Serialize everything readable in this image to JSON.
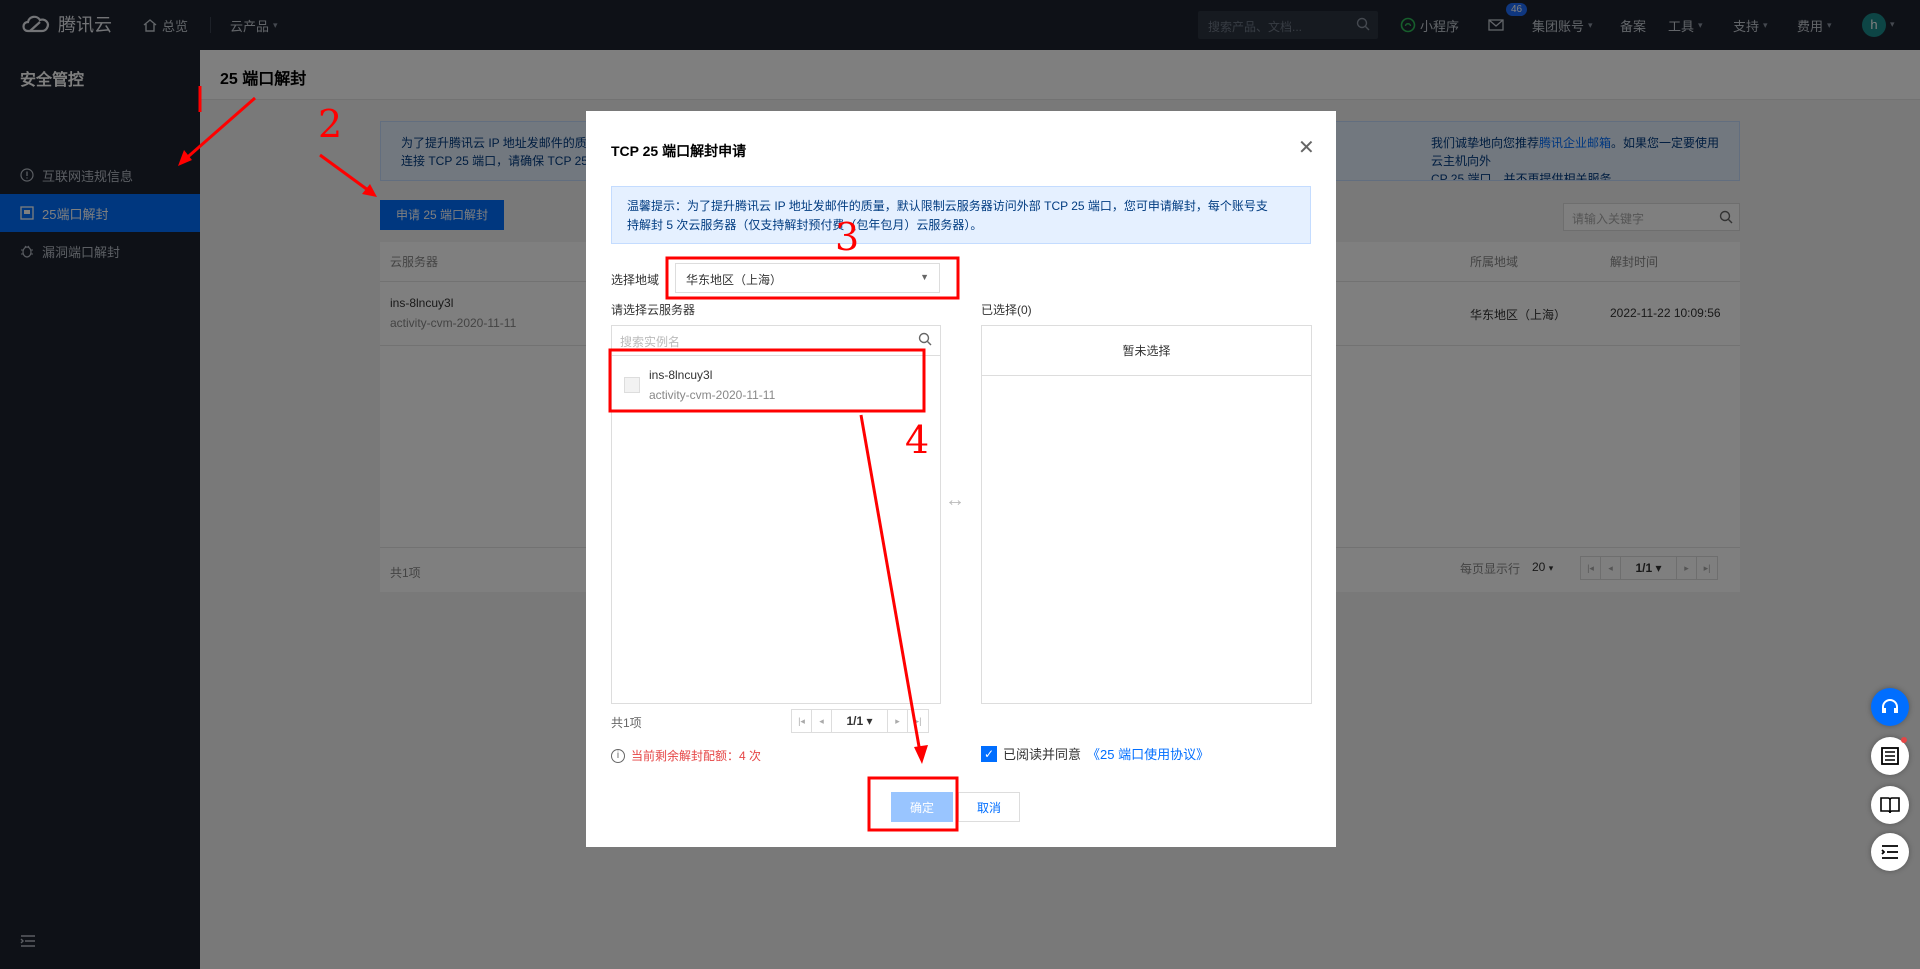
{
  "topbar": {
    "logo_text": "腾讯云",
    "overview": "总览",
    "products": "云产品",
    "search_placeholder": "搜索产品、文档...",
    "mini_program": "小程序",
    "mail_badge": "46",
    "group_account": "集团账号",
    "filing": "备案",
    "tools": "工具",
    "support": "支持",
    "billing": "费用",
    "avatar_initial": "h"
  },
  "sidebar": {
    "title": "安全管控",
    "items": [
      {
        "label": "互联网违规信息",
        "icon": "info-icon"
      },
      {
        "label": "25端口解封",
        "icon": "port-icon"
      },
      {
        "label": "漏洞端口解封",
        "icon": "bug-icon"
      }
    ]
  },
  "page": {
    "title": "25 端口解封",
    "info_line1": "为了提升腾讯云 IP 地址发邮件的质",
    "info_line2": "连接 TCP 25 端口，请确保 TCP 25",
    "info_right1_prefix": "我们诚挚地向您推荐",
    "info_right1_link": "腾讯企业邮箱",
    "info_right1_suffix": "。如果您一定要使用云主机向外",
    "info_right2": "CP 25 端口，并不再提供相关服务。",
    "apply_button": "申请 25 端口解封",
    "keyword_placeholder": "请输入关键字"
  },
  "table": {
    "headers": {
      "server": "云服务器",
      "region": "所属地域",
      "unblock_time": "解封时间"
    },
    "rows": [
      {
        "name": "ins-8lncuy3l",
        "alias": "activity-cvm-2020-11-11",
        "region": "华东地区（上海）",
        "time": "2022-11-22 10:09:56"
      }
    ],
    "total": "共1项",
    "per_page_label": "每页显示行",
    "per_page_value": "20",
    "page": "1/1"
  },
  "dialog": {
    "title": "TCP 25 端口解封申请",
    "tip_line1": "温馨提示：为了提升腾讯云 IP 地址发邮件的质量，默认限制云服务器访问外部 TCP 25 端口，您可申请解封，每个账号支",
    "tip_line2": "持解封 5 次云服务器（仅支持解封预付费（包年包月）云服务器）。",
    "region_label": "选择地域",
    "region_value": "华东地区（上海）",
    "left_label": "请选择云服务器",
    "search_placeholder": "搜索实例名",
    "instance_name": "ins-8lncuy3l",
    "instance_alias": "activity-cvm-2020-11-11",
    "right_label": "已选择(0)",
    "none_selected": "暂未选择",
    "total": "共1项",
    "page": "1/1",
    "quota_text": "当前剩余解封配额：4 次",
    "agree_text": "已阅读并同意",
    "agree_link": "《25 端口使用协议》",
    "ok_button": "确定",
    "cancel_button": "取消"
  },
  "annotations": {
    "step2": "2",
    "step3": "3",
    "step4": "4"
  },
  "colors": {
    "brand": "#006eff",
    "annotation": "#ff0000",
    "danger": "#e54545"
  }
}
